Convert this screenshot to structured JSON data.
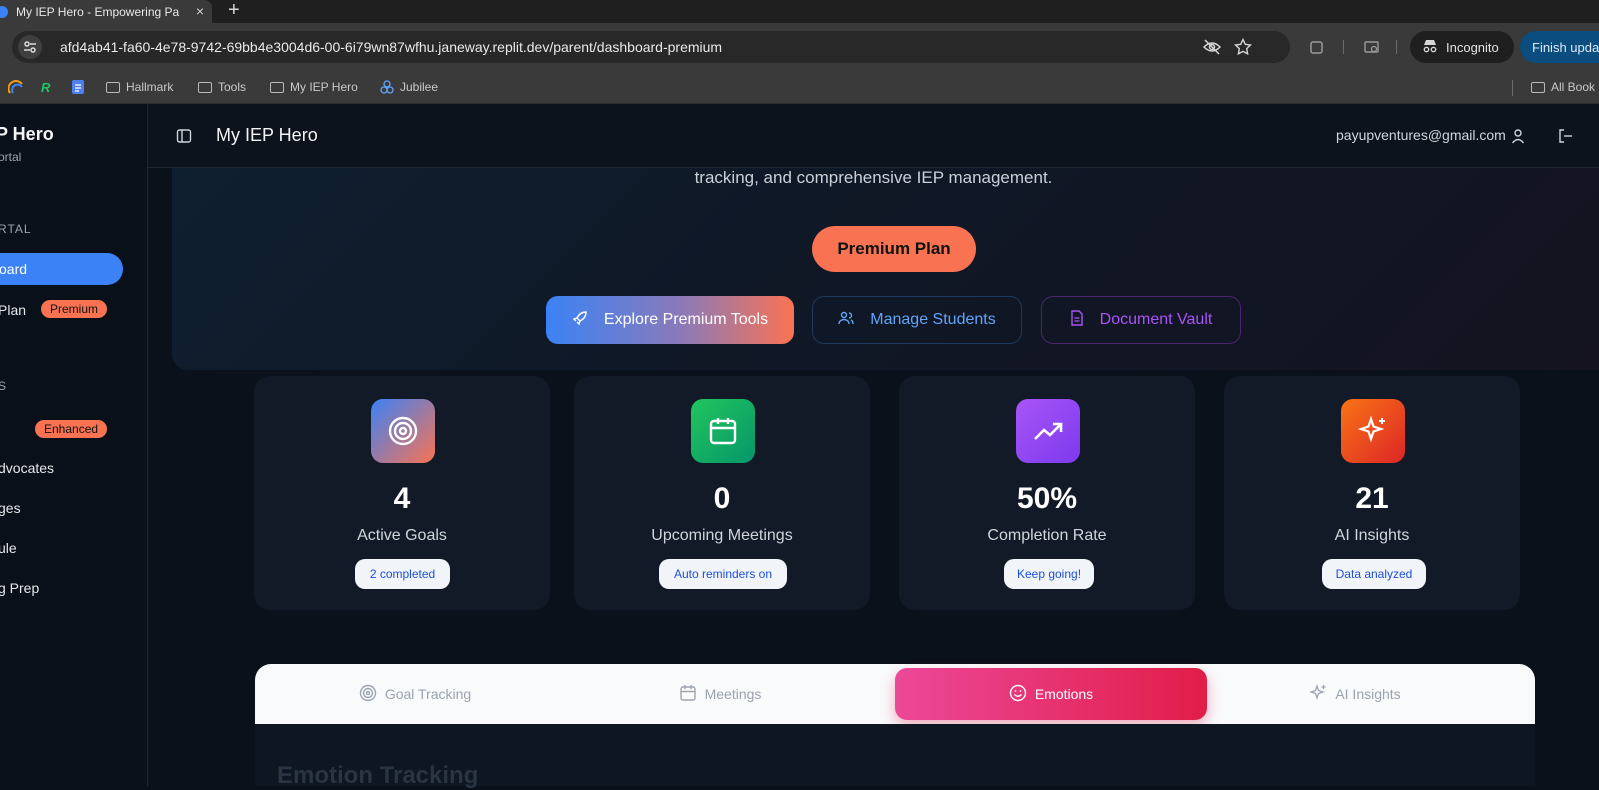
{
  "browser": {
    "tab_title": "My IEP Hero - Empowering Pa",
    "url": "afd4ab41-fa60-4e78-9742-69bb4e3004d6-00-6i79wn87wfhu.janeway.replit.dev/parent/dashboard-premium",
    "incognito_label": "Incognito",
    "update_label": "Finish upda",
    "bookmarks": [
      "Hallmark",
      "Tools",
      "My IEP Hero",
      "Jubilee"
    ],
    "all_bookmarks_label": "All Book"
  },
  "sidebar": {
    "brand": "P Hero",
    "brand_sub": "ortal",
    "section_portal": "RTAL",
    "items": [
      {
        "label": "oard",
        "active": true
      },
      {
        "label": "Plan",
        "badge": "Premium"
      },
      {
        "label": "",
        "badge": "Enhanced"
      },
      {
        "label": "dvocates"
      },
      {
        "label": "ges"
      },
      {
        "label": "ule"
      },
      {
        "label": "g Prep"
      }
    ],
    "section_tools": "S"
  },
  "header": {
    "title": "My IEP Hero",
    "email": "payupventures@gmail.com"
  },
  "hero": {
    "text": "tracking, and comprehensive IEP management.",
    "plan_label": "Premium Plan",
    "buttons": {
      "explore": "Explore Premium Tools",
      "students": "Manage Students",
      "vault": "Document Vault"
    }
  },
  "stats": [
    {
      "value": "4",
      "label": "Active Goals",
      "chip": "2 completed",
      "icon": "target-icon"
    },
    {
      "value": "0",
      "label": "Upcoming Meetings",
      "chip": "Auto reminders on",
      "icon": "calendar-icon"
    },
    {
      "value": "50%",
      "label": "Completion Rate",
      "chip": "Keep going!",
      "icon": "trending-up-icon"
    },
    {
      "value": "21",
      "label": "AI Insights",
      "chip": "Data analyzed",
      "icon": "sparkles-icon"
    }
  ],
  "tabs": {
    "items": [
      "Goal Tracking",
      "Meetings",
      "Emotions",
      "AI Insights"
    ],
    "active": "Emotions"
  },
  "content": {
    "heading": "Emotion Tracking"
  },
  "colors": {
    "accent_blue": "#3b82f6",
    "premium_orange": "#f97352",
    "emotions_pink": "#e11d48",
    "background": "#0b111b"
  }
}
